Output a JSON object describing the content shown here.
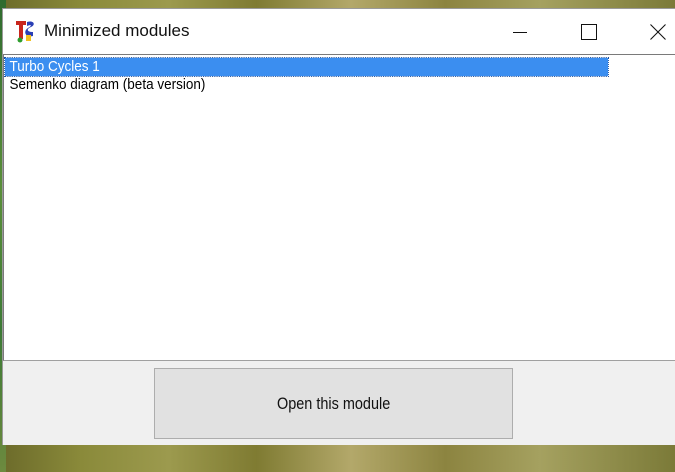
{
  "window": {
    "title": "Minimized modules",
    "controls": {
      "minimize_icon": "minimize-icon",
      "maximize_icon": "maximize-icon",
      "close_icon": "close-icon"
    }
  },
  "list": {
    "items": [
      {
        "label": "Turbo Cycles 1",
        "selected": true
      },
      {
        "label": "Semenko diagram (beta version)",
        "selected": false
      }
    ]
  },
  "actions": {
    "open_label": "Open this module"
  },
  "colors": {
    "selection": "#3b8ef0",
    "button_face": "#e1e1e1",
    "window_bg": "#f0f0f0"
  }
}
